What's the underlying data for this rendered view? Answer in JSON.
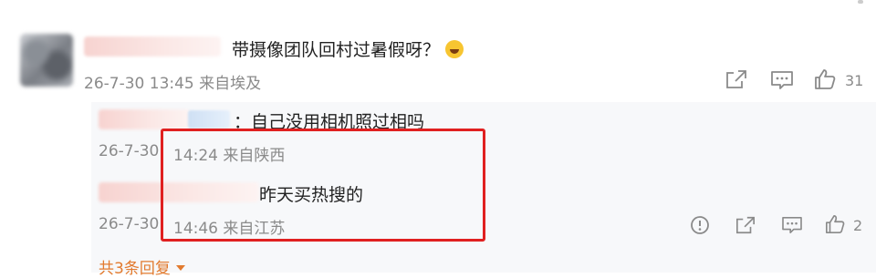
{
  "comment": {
    "text": "带摄像团队回村过暑假呀？",
    "emoji": "laughing-tears",
    "time": "26-7-30 13:45",
    "location": "来自埃及",
    "like_count": "31"
  },
  "replies": [
    {
      "text": "：自己没用相机照过相吗",
      "time_prefix": "26-7-30",
      "time_suffix": "14:24 来自陕西"
    },
    {
      "text": "昨天买热搜的",
      "time_prefix": "26-7-30",
      "time_suffix": "14:46 来自江苏",
      "like_count": "2"
    }
  ],
  "more_replies_label": "共3条回复",
  "colors": {
    "highlight_border": "#e02020",
    "more_link": "#e27a2e",
    "reply_bg": "#f7f8fa",
    "meta_text": "#8a8a8a"
  }
}
